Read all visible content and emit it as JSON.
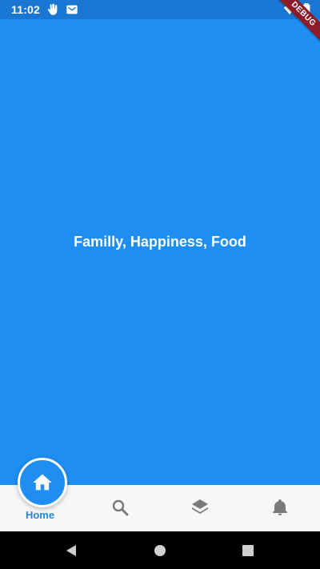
{
  "status_bar": {
    "time": "11:02",
    "left_icons": [
      "hand-icon",
      "mail-icon"
    ],
    "right_icons": [
      "wifi-icon",
      "battery-icon"
    ],
    "debug_banner": "DEBUG"
  },
  "content": {
    "text": "Familly, Happiness, Food",
    "background": "#1e8ef2"
  },
  "bottom_nav": {
    "items": [
      {
        "label": "Home",
        "icon": "home-icon",
        "active": true
      },
      {
        "label": "",
        "icon": "search-icon",
        "active": false
      },
      {
        "label": "",
        "icon": "layers-icon",
        "active": false
      },
      {
        "label": "",
        "icon": "bell-icon",
        "active": false
      }
    ],
    "active_color": "#1e88e5",
    "inactive_color": "#7a7a7a"
  },
  "system_nav": {
    "buttons": [
      "back-icon",
      "home-circle-icon",
      "recents-square-icon"
    ]
  }
}
